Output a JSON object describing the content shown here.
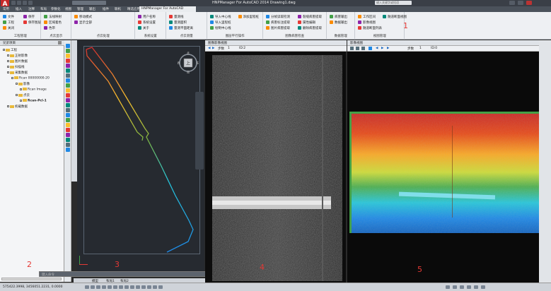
{
  "app": {
    "logo": "A",
    "title": "HNPManager For AutoCAD 2014    Drawing1.dwg",
    "search_placeholder": "键入关键字或短语"
  },
  "menubar": {
    "items": [
      "常用",
      "插入",
      "注释",
      "布局",
      "参数化",
      "视图",
      "管理",
      "输出",
      "插件",
      "联机",
      "精选应用",
      "HNPManager For AutoCAD"
    ],
    "active": "HNPManager For AutoCAD"
  },
  "ribbon": {
    "groups": [
      {
        "label": "工程管理",
        "buttons": [
          "文件",
          "工程",
          "关闭",
          "保存",
          "保存图层"
        ]
      },
      {
        "label": "点云显示",
        "buttons": [
          "法线映射",
          "区域着色",
          "色带"
        ]
      },
      {
        "label": "点云处理",
        "buttons": [
          "移动模式",
          "显示全部"
        ]
      },
      {
        "label": "系统设置",
        "buttons": [
          "用户名称",
          "系统设置",
          "关于"
        ]
      },
      {
        "label": "点云测量",
        "buttons": [
          "量测线",
          "量测面积",
          "量测平面距离"
        ]
      },
      {
        "label": "图层平行操作",
        "buttons": [
          "导入中心线",
          "导入里程桩",
          "绘制中心线",
          "添加里程桩"
        ]
      },
      {
        "label": "图像病害检查",
        "buttons": [
          "分帧读取检测",
          "病害标注提取",
          "图片病害提取",
          "裂缝病害提取",
          "属性编辑",
          "删除病害提取"
        ]
      },
      {
        "label": "数据管理",
        "buttons": [
          "病害输出",
          "数据输出"
        ]
      },
      {
        "label": "视图管理",
        "buttons": [
          "工作区间",
          "影像视图",
          "隧道断面列表",
          "隧道断面视图"
        ]
      }
    ],
    "annotation": "1"
  },
  "left_panel": {
    "title": "兄弟项目",
    "tree": [
      {
        "label": "工程",
        "level": 0
      },
      {
        "label": "正射影像",
        "level": 1
      },
      {
        "label": "图片数据",
        "level": 1
      },
      {
        "label": "扫描线",
        "level": 1
      },
      {
        "label": "采集数据",
        "level": 1
      },
      {
        "label": "Rcan 00000000-20",
        "level": 2
      },
      {
        "label": "影像",
        "level": 3
      },
      {
        "label": "Rcan Image",
        "level": 4
      },
      {
        "label": "点云",
        "level": 3
      },
      {
        "label": "Rcan-Pcl-1",
        "level": 4
      },
      {
        "label": "机载数据",
        "level": 1
      }
    ],
    "annotation": "2"
  },
  "cad_view": {
    "annotation": "3",
    "viewcube_label": "上",
    "compass": {
      "n": "北",
      "s": "南",
      "e": "东",
      "w": "西"
    }
  },
  "command_line": {
    "prompt": "键入命令"
  },
  "layout_tabs": [
    "模型",
    "布局1",
    "布局2"
  ],
  "gray_panel": {
    "title": "图像影像视图",
    "frame_label": "步数",
    "frame_value": "1",
    "id_label": "ID:2",
    "annotation": "4"
  },
  "color_panel": {
    "title": "影像视图",
    "frame_label": "步数",
    "frame_value": "1",
    "id_label": "ID:0",
    "annotation": "5"
  },
  "status": {
    "coords": "575422.3998, 3456051.2231, 0.0000"
  },
  "colors": {
    "logo": "#c62828",
    "annotation": "#e53935",
    "trajectory_start": "#d32f2f",
    "trajectory_end": "#1e88e5"
  }
}
